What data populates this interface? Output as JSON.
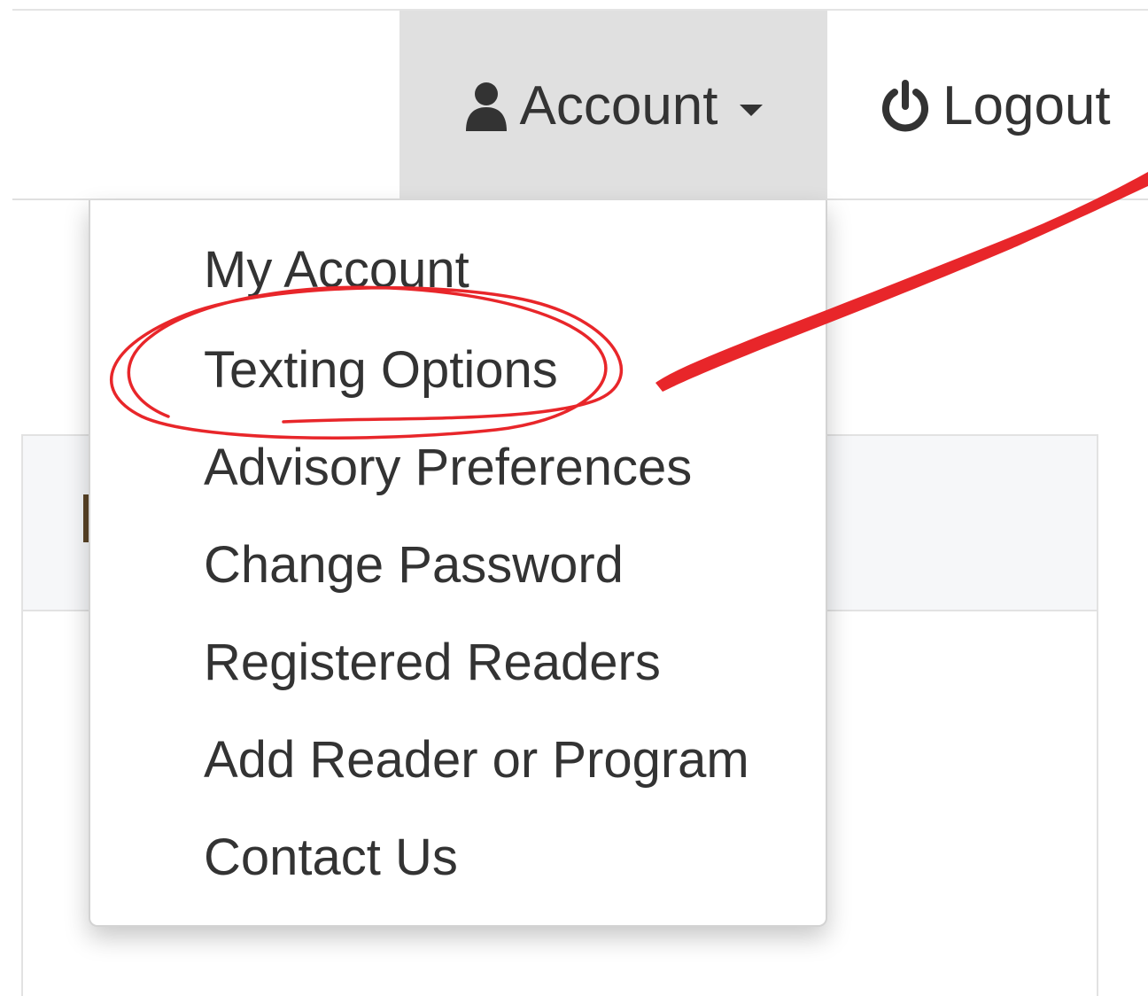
{
  "navbar": {
    "account_label": "Account",
    "logout_label": "Logout"
  },
  "dropdown": {
    "items": [
      {
        "label": "My Account"
      },
      {
        "label": "Texting Options"
      },
      {
        "label": "Advisory Preferences"
      },
      {
        "label": "Change Password"
      },
      {
        "label": "Registered Readers"
      },
      {
        "label": "Add Reader or Program"
      },
      {
        "label": "Contact Us"
      }
    ]
  },
  "annotation": {
    "highlighted_item": "Texting Options",
    "color": "#e8262a"
  },
  "colors": {
    "active_nav_bg": "#e0e0e0",
    "text": "#333333",
    "panel_header_bg": "#f6f7f9"
  }
}
